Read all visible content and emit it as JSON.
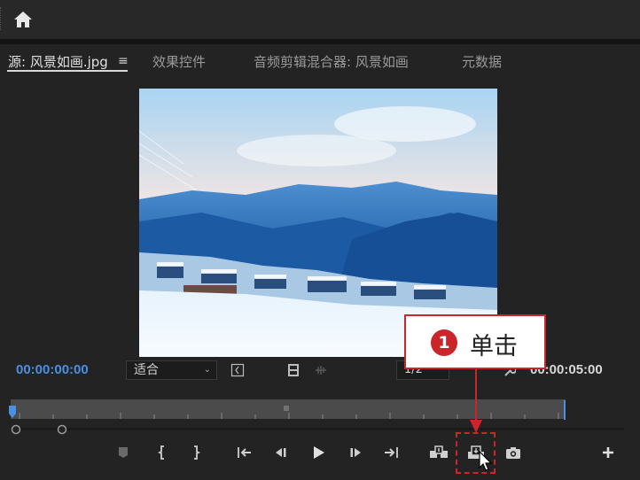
{
  "topbar": {
    "home_icon": "home-icon"
  },
  "tabs": [
    {
      "label": "源: 风景如画.jpg",
      "active": true
    },
    {
      "label": "效果控件",
      "active": false
    },
    {
      "label": "音频剪辑混合器: 风景如画",
      "active": false
    },
    {
      "label": "元数据",
      "active": false
    }
  ],
  "tab_menu_icon": "≡",
  "timecode": {
    "current": "00:00:00:00",
    "duration": "00:00:05:00"
  },
  "zoom_select": {
    "value": "适合",
    "chevron": "⌄"
  },
  "resolution_select": {
    "value": "1/2"
  },
  "callout": {
    "number": "1",
    "text": "单击"
  },
  "colors": {
    "accent_blue": "#4a90e2",
    "callout_red": "#c9252b",
    "panel_bg": "#232323"
  },
  "controls": [
    "add-marker-icon",
    "mark-in-icon",
    "mark-out-icon",
    "go-to-in-icon",
    "step-back-icon",
    "play-icon",
    "step-forward-icon",
    "go-to-out-icon",
    "insert-icon",
    "overwrite-icon",
    "export-frame-icon",
    "add-button-icon"
  ]
}
